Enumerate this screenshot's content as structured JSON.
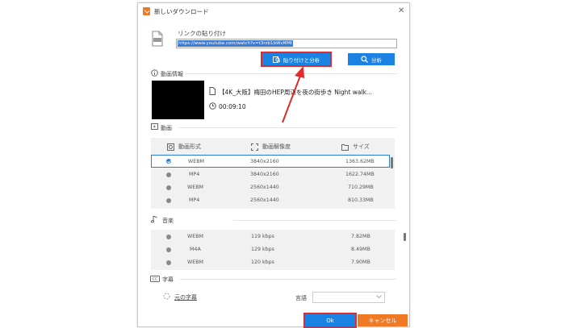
{
  "window": {
    "title": "新しいダウンロード",
    "close_glyph": "✕"
  },
  "link": {
    "label": "リンクの貼り付け",
    "url_value": "https://www.youtube.com/watch?v=t3rzb1bWvMMI",
    "paste_button": "貼り付けと分析",
    "analyze_button": "分析"
  },
  "video_info": {
    "section": "動画情報",
    "title": "【4K_大阪】梅田のHEP周辺を夜の街歩き Night walk...",
    "duration": "00:09:10"
  },
  "video": {
    "section": "動画",
    "headers": {
      "format": "動画形式",
      "resolution": "動画解像度",
      "size": "サイズ"
    },
    "rows": [
      {
        "format": "WEBM",
        "resolution": "3840x2160",
        "size": "1363.62MB",
        "selected": true
      },
      {
        "format": "MP4",
        "resolution": "3840x2160",
        "size": "1622.74MB",
        "selected": false
      },
      {
        "format": "WEBM",
        "resolution": "2560x1440",
        "size": "710.29MB",
        "selected": false
      },
      {
        "format": "MP4",
        "resolution": "2560x1440",
        "size": "810.33MB",
        "selected": false
      }
    ]
  },
  "audio": {
    "section": "音楽",
    "rows": [
      {
        "format": "WEBM",
        "bitrate": "119 kbps",
        "size": "7.82MB"
      },
      {
        "format": "M4A",
        "bitrate": "129 kbps",
        "size": "8.49MB"
      },
      {
        "format": "WEBM",
        "bitrate": "120 kbps",
        "size": "7.90MB"
      }
    ]
  },
  "subtitle": {
    "section": "字幕",
    "option": "元の字幕",
    "language_label": "言語",
    "language_value": ""
  },
  "footer": {
    "ok": "Ok",
    "cancel": "キャンセル"
  },
  "colors": {
    "accent": "#1a82e2",
    "cancel": "#f07a23",
    "highlight": "#e12a2a"
  }
}
